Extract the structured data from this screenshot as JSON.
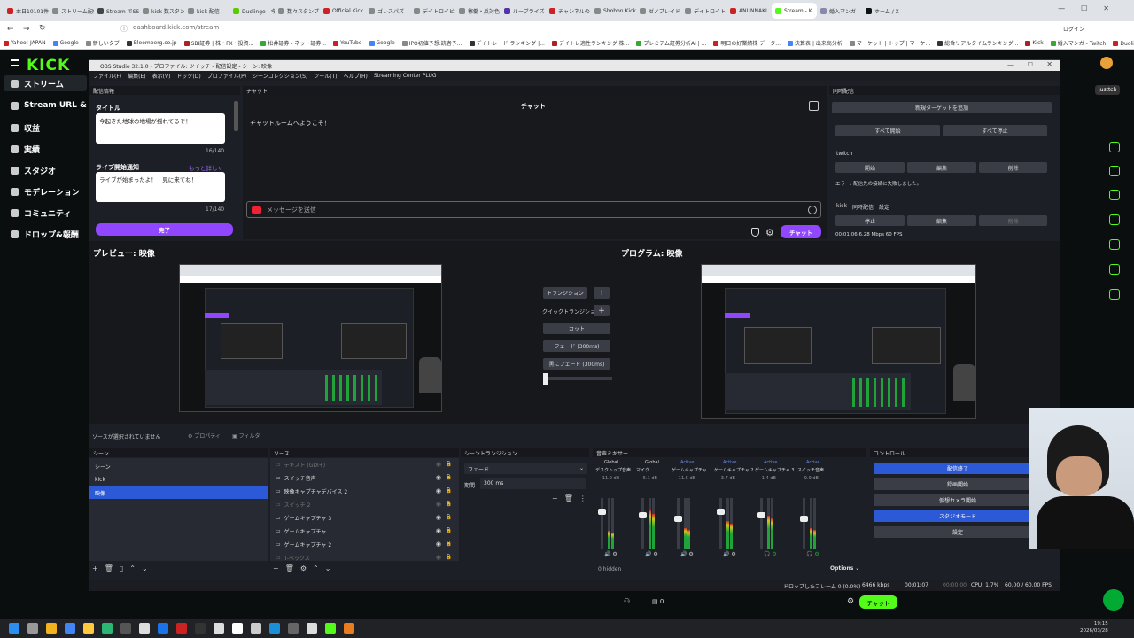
{
  "browser": {
    "tabs": [
      {
        "label": "本日10101件",
        "color": "#c22"
      },
      {
        "label": "ストリーム配信",
        "color": "#888"
      },
      {
        "label": "Stream でSSSを",
        "color": "#444"
      },
      {
        "label": "kick 数スタン",
        "color": "#888"
      },
      {
        "label": "kick 配信",
        "color": "#888"
      },
      {
        "label": "Duolingo - 今",
        "color": "#58cc02"
      },
      {
        "label": "数々スタンプ",
        "color": "#888"
      },
      {
        "label": "Official Kick",
        "color": "#c22"
      },
      {
        "label": "ゴレスパズ",
        "color": "#888"
      },
      {
        "label": "デイトロイビカ",
        "color": "#888"
      },
      {
        "label": "稼働・反対色",
        "color": "#888"
      },
      {
        "label": "ルーブライズ",
        "color": "#53a"
      },
      {
        "label": "チャンネルの",
        "color": "#c22"
      },
      {
        "label": "Shobon Kick",
        "color": "#888"
      },
      {
        "label": "ゼノブレイド",
        "color": "#888"
      },
      {
        "label": "デイトロイトブ",
        "color": "#888"
      },
      {
        "label": "ANUNNAKI",
        "color": "#c22"
      },
      {
        "label": "Stream - K",
        "color": "#53fc18"
      },
      {
        "label": "婚入マンガ",
        "color": "#88a"
      },
      {
        "label": "ホーム / X",
        "color": "#111"
      }
    ],
    "url": "dashboard.kick.com/stream",
    "bookmarks": [
      "Yahoo! JAPAN",
      "Google",
      "新しいタブ",
      "Bloomberg.co.jp",
      "SBI証券 | 株・FX・投資...",
      "松井証券 - ネット証券...",
      "YouTube",
      "Google",
      "IPO初値予想:読者予...",
      "デイトレード ランキング |...",
      "デイトレ適性ランキング 株...",
      "プレミアム証券分析AI | ...",
      "明日の好業績株 データ...",
      "決算表 | 出来高分析",
      "マーケット | トップ | マーケ...",
      "総合リアルタイムランキング...",
      "Kick",
      "婚入マンガ - Twitch",
      "Duolingo - 学習効果が..."
    ],
    "profile": "ログイン"
  },
  "kick": {
    "logo": "KICK",
    "nav": [
      {
        "label": "ストリーム",
        "active": true
      },
      {
        "label": "Stream URL & Key",
        "active": false
      },
      {
        "label": "収益",
        "active": false
      },
      {
        "label": "実績",
        "active": false
      },
      {
        "label": "スタジオ",
        "active": false
      },
      {
        "label": "モデレーション",
        "active": false
      },
      {
        "label": "コミュニティ",
        "active": false
      },
      {
        "label": "ドロップ&報酬",
        "active": false
      }
    ],
    "user_tag": "justtch"
  },
  "obs": {
    "title": "OBS Studio 32.1.0 - プロファイル: ツイッチ - 配信設定 - シーン: 映像",
    "menu": [
      "ファイル(F)",
      "編集(E)",
      "表示(V)",
      "ドック(D)",
      "プロファイル(P)",
      "シーンコレクション(S)",
      "ツール(T)",
      "ヘルプ(H)",
      "Streaming Center PLUG"
    ],
    "stream_info": {
      "dock_title": "配信情報",
      "title_label": "タイトル",
      "title_value": "今起きた地球の地場が揺れてるぞ！",
      "title_count": "16/140",
      "notify_label": "ライブ開始通知",
      "notify_more": "もっと詳しく",
      "notify_value": "ライブが始まったよ！　見に来てね！",
      "notify_count": "17/140",
      "done_button": "完了"
    },
    "chat": {
      "dock_title": "チャット",
      "header": "チャット",
      "welcome": "チャットルームへようこそ！",
      "placeholder": "メッセージを送信",
      "send_button": "チャット"
    },
    "multistream": {
      "dock_title": "同時配信",
      "new_target": "新規ターゲットを追加",
      "start_all": "すべて開始",
      "stop_all": "すべて停止",
      "twitch_label": "twitch",
      "twitch_start": "開始",
      "twitch_edit": "編集",
      "twitch_delete": "削除",
      "twitch_error": "エラー: 配信先の接続に失敗しました。",
      "kick_label": "kick",
      "kick_tabs": "同時配信　設定",
      "kick_stop": "停止",
      "kick_edit": "編集",
      "kick_delete": "削除",
      "kick_status": "00:01:06  6.28 Mbps  60 FPS"
    },
    "preview_label": "プレビュー: 映像",
    "program_label": "プログラム: 映像",
    "transitions": {
      "transition": "トランジション",
      "quick": "クイックトランジション",
      "cut": "カット",
      "fade": "フェード (300ms)",
      "fade_black": "黒にフェード (300ms)"
    },
    "source_bar": {
      "no_source": "ソースが選択されていません",
      "properties": "プロパティ",
      "filters": "フィルタ"
    },
    "scenes": {
      "title": "シーン",
      "items": [
        "シーン",
        "kick",
        "映像"
      ],
      "selected": 2
    },
    "sources": {
      "title": "ソース",
      "items": [
        "テキスト (GDI+)",
        "スイッチ音声",
        "映像キャプチャデバイス 2",
        "スイッチ 2",
        "ゲームキャプチャ 3",
        "ゲームキャプチャ",
        "ゲームキャプチャ 2",
        "T-ベックス"
      ]
    },
    "scene_transition": {
      "title": "シーントランジション",
      "type": "フェード",
      "duration_label": "期間",
      "duration": "300 ms"
    },
    "mixer": {
      "title": "音声ミキサー",
      "channels": [
        {
          "group": "Global",
          "name": "デスクトップ音声",
          "db": "-11.9 dB",
          "level": 0.35
        },
        {
          "group": "Global",
          "name": "マイク",
          "db": "-5.1 dB",
          "level": 0.75
        },
        {
          "group": "Active",
          "name": "ゲームキャプチャ",
          "db": "-11.5 dB",
          "level": 0.4
        },
        {
          "group": "Active",
          "name": "ゲームキャプチャ 2",
          "db": "-3.7 dB",
          "level": 0.55
        },
        {
          "group": "Active",
          "name": "ゲームキャプチャ 3",
          "db": "-1.4 dB",
          "level": 0.65
        },
        {
          "group": "Active",
          "name": "スイッチ音声",
          "db": "-9.9 dB",
          "level": 0.4
        }
      ],
      "hidden": "0 hidden",
      "options": "Options"
    },
    "controls": {
      "title": "コントロール",
      "buttons": [
        {
          "label": "配信終了",
          "active": true
        },
        {
          "label": "録画開始",
          "active": false
        },
        {
          "label": "仮想カメラ開始",
          "active": false
        },
        {
          "label": "スタジオモード",
          "active": true
        },
        {
          "label": "設定",
          "active": false
        }
      ]
    },
    "status": {
      "dropped": "ドロップしたフレーム 0 (0.0%)",
      "bitrate": "6466 kbps",
      "time1": "00:01:07",
      "time2": "00:00:00",
      "cpu": "CPU: 1.7%",
      "fps": "60.00 / 60.00 FPS"
    }
  },
  "bottom_bar": {
    "count": "0",
    "chat_button": "チャット"
  },
  "taskbar": {
    "time": "19:15",
    "date": "2026/03/28"
  },
  "colors": {
    "kick_green": "#53fc18",
    "purple": "#9147ff",
    "obs_blue": "#2c5ad6"
  }
}
